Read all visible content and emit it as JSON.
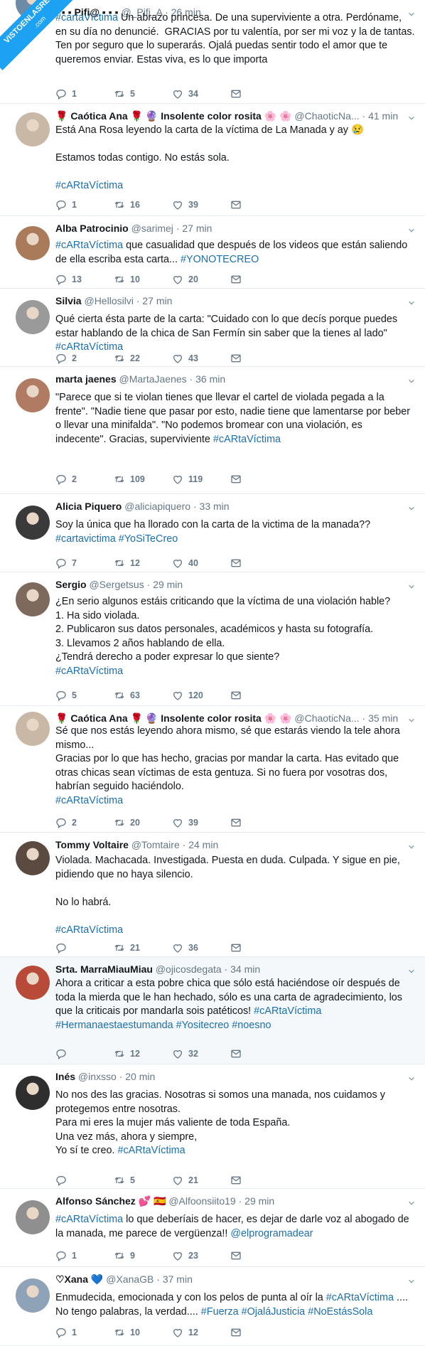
{
  "watermark": {
    "line1": "VISTOENLASREDES",
    "line2": ".com"
  },
  "tweets": [
    {
      "name": "▪ ▪ ▪ Pifi@ ▪ ▪ ▪",
      "handle": "@_Pifi_A",
      "time": "26 min",
      "text_parts": [
        {
          "t": "#cartaVíctima",
          "k": "tag"
        },
        {
          "t": " Un abrazo princesa. De una superviviente a otra. Perdóname, en su día no denuncié.  GRACIAS por tu valentía, por ser mi voz y la de tantas. Ten por seguro que lo superarás. Ojalá puedas sentir todo el amor que te queremos enviar. Estas viva, es lo que importa",
          "k": ""
        }
      ],
      "replies": "1",
      "retweets": "5",
      "likes": "34",
      "avatar_color": "#6d8aa6"
    },
    {
      "name": "🌹 Caótica Ana 🌹 🔮 Insolente color rosita 🌸 🌸",
      "handle": "@ChaoticNa...",
      "time": "41 min",
      "text_parts": [
        {
          "t": "Está Ana Rosa leyendo la carta de la víctima de La Manada y ay 😢\n\nEstamos todas contigo. No estás sola.\n\n",
          "k": ""
        },
        {
          "t": "#cARtaVíctima",
          "k": "tag"
        }
      ],
      "replies": "1",
      "retweets": "16",
      "likes": "39",
      "avatar_color": "#c9b8a6"
    },
    {
      "name": "Alba Patrocinio",
      "handle": "@sarimej",
      "time": "27 min",
      "text_parts": [
        {
          "t": "#cARtaVíctima",
          "k": "tag"
        },
        {
          "t": " que casualidad que después de los videos que están saliendo de ella escriba esta carta... ",
          "k": ""
        },
        {
          "t": "#YONOTECREO",
          "k": "tag"
        }
      ],
      "replies": "13",
      "retweets": "10",
      "likes": "20",
      "avatar_color": "#a97b5b"
    },
    {
      "name": "Silvia",
      "handle": "@Hellosilvi",
      "time": "27 min",
      "text_parts": [
        {
          "t": "Qué cierta ésta parte de la carta: \"Cuidado con lo que decís porque puedes estar hablando de la chica de San Fermín sin saber que la tienes al lado\"\n",
          "k": ""
        },
        {
          "t": "#cARtaVíctima",
          "k": "tag"
        }
      ],
      "replies": "2",
      "retweets": "22",
      "likes": "43",
      "avatar_color": "#9a9a9a"
    },
    {
      "name": "marta jaenes",
      "handle": "@MartaJaenes",
      "time": "36 min",
      "text_parts": [
        {
          "t": "\"Parece que si te violan tienes que llevar el cartel de violada pegada a la frente\". \"Nadie tiene que pasar por esto, nadie tiene que lamentarse por beber o llevar una minifalda\". \"No podemos bromear con una violación, es indecente\". Gracias, superviviente ",
          "k": ""
        },
        {
          "t": "#cARtaVíctima",
          "k": "tag"
        }
      ],
      "replies": "2",
      "retweets": "109",
      "likes": "119",
      "avatar_color": "#b07b62"
    },
    {
      "name": "Alicia Piquero",
      "handle": "@aliciapiquero",
      "time": "33 min",
      "text_parts": [
        {
          "t": "Soy la única que ha llorado con la carta de la victima de la manada??\n",
          "k": ""
        },
        {
          "t": "#cartavictima",
          "k": "tag"
        },
        {
          "t": " ",
          "k": ""
        },
        {
          "t": "#YoSiTeCreo",
          "k": "tag"
        }
      ],
      "replies": "7",
      "retweets": "12",
      "likes": "40",
      "avatar_color": "#3a3a3a"
    },
    {
      "name": "Sergio",
      "handle": "@Sergetsus",
      "time": "29 min",
      "text_parts": [
        {
          "t": "¿En serio algunos estáis criticando que la víctima de una violación hable?\n1. Ha sido violada.\n2. Publicaron sus datos personales, académicos y hasta su fotografía.\n3. Llevamos 2 años hablando de ella.\n¿Tendrá derecho a poder expresar lo que siente?\n",
          "k": ""
        },
        {
          "t": "#cARtaVíctima",
          "k": "tag"
        }
      ],
      "replies": "5",
      "retweets": "63",
      "likes": "120",
      "avatar_color": "#7d6a5c"
    },
    {
      "name": "🌹 Caótica Ana 🌹 🔮 Insolente color rosita 🌸 🌸",
      "handle": "@ChaoticNa...",
      "time": "35 min",
      "text_parts": [
        {
          "t": "Sé que nos estás leyendo ahora mismo, sé que estarás viendo la tele ahora mismo...\nGracias por lo que has hecho, gracias por mandar la carta. Has evitado que otras chicas sean víctimas de esta gentuza. Si no fuera por vosotras dos, habrían seguido haciéndolo.\n",
          "k": ""
        },
        {
          "t": "#cARtaVíctima",
          "k": "tag"
        }
      ],
      "replies": "2",
      "retweets": "20",
      "likes": "39",
      "avatar_color": "#c9b8a6"
    },
    {
      "name": "Tommy Voltaire",
      "handle": "@Tomtaire",
      "time": "24 min",
      "text_parts": [
        {
          "t": "Violada. Machacada. Investigada. Puesta en duda. Culpada. Y sigue en pie, pidiendo que no haya silencio.\n\nNo lo habrá.\n\n",
          "k": ""
        },
        {
          "t": "#cARtaVíctima",
          "k": "tag"
        }
      ],
      "replies": "",
      "retweets": "21",
      "likes": "36",
      "avatar_color": "#5b4a3f"
    },
    {
      "name": "Srta. MarraMiauMiau",
      "handle": "@ojicosdegata",
      "time": "34 min",
      "text_parts": [
        {
          "t": "Ahora a criticar a esta pobre chica que sólo está haciéndose oír después de toda la mierda que le han hechado, sólo es una carta de agradecimiento, los que la criticais por mandarla sois patéticos! ",
          "k": ""
        },
        {
          "t": "#cARtaVíctima",
          "k": "tag"
        },
        {
          "t": "\n",
          "k": ""
        },
        {
          "t": "#Hermanaestaestumanda",
          "k": "tag"
        },
        {
          "t": " ",
          "k": ""
        },
        {
          "t": "#Yositecreo",
          "k": "tag"
        },
        {
          "t": " ",
          "k": ""
        },
        {
          "t": "#noesno",
          "k": "tag"
        }
      ],
      "replies": "",
      "retweets": "12",
      "likes": "32",
      "avatar_color": "#b84a3a"
    },
    {
      "name": "Inés",
      "handle": "@inxsso",
      "time": "20 min",
      "text_parts": [
        {
          "t": "No nos des las gracias. Nosotras si somos una manada, nos cuidamos y protegemos entre nosotras.\nPara mi eres la mujer más valiente de toda España.\nUna vez más, ahora y siempre,\nYo sí te creo. ",
          "k": ""
        },
        {
          "t": "#cARtaVíctima",
          "k": "tag"
        }
      ],
      "replies": "",
      "retweets": "5",
      "likes": "21",
      "avatar_color": "#2e2e2e"
    },
    {
      "name": "Alfonso Sánchez 💕 🇪🇸",
      "handle": "@Alfoonsiito19",
      "time": "29 min",
      "text_parts": [
        {
          "t": "#cARtaVíctima",
          "k": "tag"
        },
        {
          "t": " lo que deberíais de hacer, es dejar de darle voz al abogado de la manada, me parece de vergüenza!! ",
          "k": ""
        },
        {
          "t": "@elprogramadear",
          "k": "mention"
        }
      ],
      "replies": "1",
      "retweets": "9",
      "likes": "23",
      "avatar_color": "#8f8f8f"
    },
    {
      "name": "♡Xana 💙",
      "handle": "@XanaGB",
      "time": "37 min",
      "text_parts": [
        {
          "t": "Enmudecida, emocionada y con los pelos de punta al oír la ",
          "k": ""
        },
        {
          "t": "#cARtaVíctima",
          "k": "tag"
        },
        {
          "t": " ....\nNo tengo palabras, la verdad.... ",
          "k": ""
        },
        {
          "t": "#Fuerza",
          "k": "tag"
        },
        {
          "t": " ",
          "k": ""
        },
        {
          "t": "#OjaláJusticia",
          "k": "tag"
        },
        {
          "t": " ",
          "k": ""
        },
        {
          "t": "#NoEstásSola",
          "k": "tag"
        }
      ],
      "replies": "1",
      "retweets": "10",
      "likes": "12",
      "avatar_color": "#8fa3b8"
    }
  ]
}
